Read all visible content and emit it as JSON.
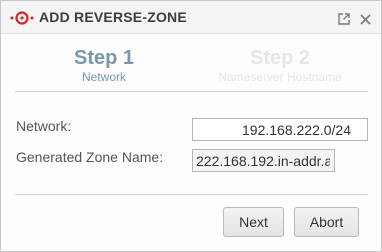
{
  "window": {
    "title": "ADD REVERSE-ZONE"
  },
  "steps": [
    {
      "title": "Step 1",
      "subtitle": "Network",
      "state": "active"
    },
    {
      "title": "Step 2",
      "subtitle": "Nameserver Hostname",
      "state": "inactive"
    }
  ],
  "form": {
    "network_label": "Network:",
    "network_value": "192.168.222.0/24",
    "zone_label": "Generated Zone Name:",
    "zone_value": "222.168.192.in-addr.a"
  },
  "buttons": {
    "next_label": "Next",
    "abort_label": "Abort"
  },
  "icons": {
    "app_logo": "app-logo-icon",
    "popout": "popout-icon",
    "close": "close-icon"
  },
  "colors": {
    "active_step": "#7a98ad",
    "inactive_step": "#e6e6e6",
    "logo_red": "#d9232a"
  }
}
